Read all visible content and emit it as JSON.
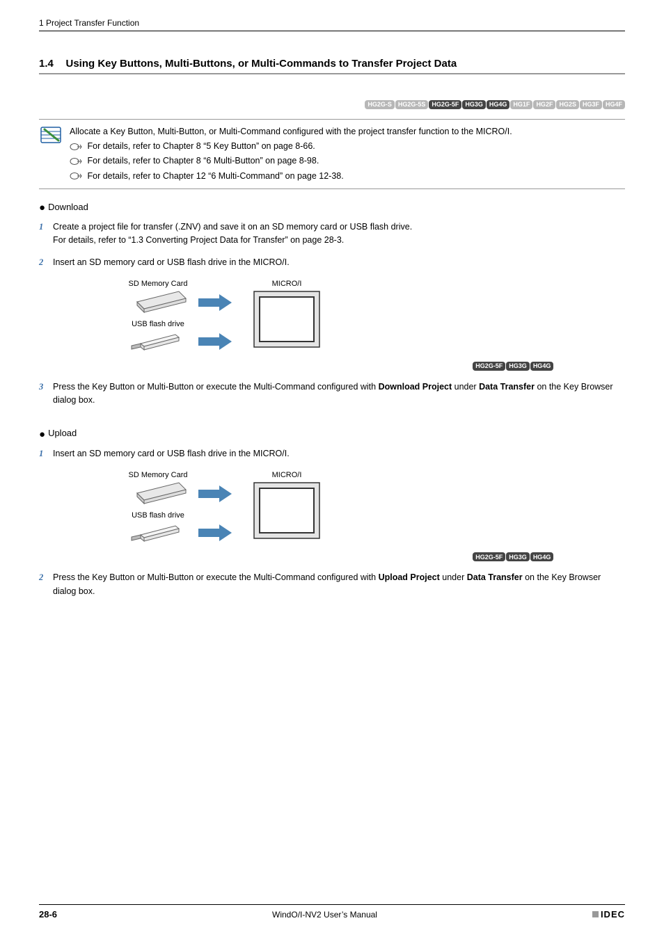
{
  "breadcrumb": "1 Project Transfer Function",
  "section": {
    "num": "1.4",
    "title": "Using Key Buttons, Multi-Buttons, or Multi-Commands to Transfer Project Data"
  },
  "topBadges": [
    {
      "label": "HG2G-S",
      "style": "grey"
    },
    {
      "label": "HG2G-5S",
      "style": "grey"
    },
    {
      "label": "HG2G-5F",
      "style": "dark"
    },
    {
      "label": "HG3G",
      "style": "dark"
    },
    {
      "label": "HG4G",
      "style": "dark"
    },
    {
      "label": "HG1F",
      "style": "grey"
    },
    {
      "label": "HG2F",
      "style": "grey"
    },
    {
      "label": "HG2S",
      "style": "grey"
    },
    {
      "label": "HG3F",
      "style": "grey"
    },
    {
      "label": "HG4F",
      "style": "grey"
    }
  ],
  "note": {
    "main": "Allocate a Key Button, Multi-Button, or Multi-Command configured with the project transfer function to the MICRO/I.",
    "refs": [
      "For details, refer to Chapter 8 “5 Key Button” on page 8-66.",
      "For details, refer to Chapter 8 “6 Multi-Button” on page 8-98.",
      "For details, refer to Chapter 12 “6 Multi-Command” on page 12-38."
    ]
  },
  "download": {
    "heading": "Download",
    "steps": [
      {
        "num": "1",
        "lines": [
          "Create a project file for transfer (.ZNV) and save it on an SD memory card or USB flash drive.",
          "For details, refer to “1.3 Converting Project Data for Transfer” on page 28-3."
        ]
      },
      {
        "num": "2",
        "lines": [
          "Insert an SD memory card or USB flash drive in the MICRO/I."
        ]
      },
      {
        "num": "3",
        "pre": "Press the Key Button or Multi-Button or execute the Multi-Command configured with ",
        "bold1": "Download Project",
        "mid": " under ",
        "bold2": "Data Transfer",
        "post": " on the Key Browser dialog box."
      }
    ]
  },
  "upload": {
    "heading": "Upload",
    "steps": [
      {
        "num": "1",
        "lines": [
          "Insert an SD memory card or USB flash drive in the MICRO/I."
        ]
      },
      {
        "num": "2",
        "pre": "Press the Key Button or Multi-Button or execute the Multi-Command configured with ",
        "bold1": "Upload Project",
        "mid": " under ",
        "bold2": "Data Transfer",
        "post": " on the Key Browser dialog box."
      }
    ]
  },
  "diagram": {
    "sdLabel": "SD Memory Card",
    "usbLabel": "USB flash drive",
    "microLabel": "MICRO/I",
    "badges": [
      {
        "label": "HG2G-5F",
        "style": "dark"
      },
      {
        "label": "HG3G",
        "style": "dark"
      },
      {
        "label": "HG4G",
        "style": "dark"
      }
    ]
  },
  "footer": {
    "page": "28-6",
    "manual": "WindO/I-NV2 User’s Manual",
    "brand": "IDEC"
  }
}
